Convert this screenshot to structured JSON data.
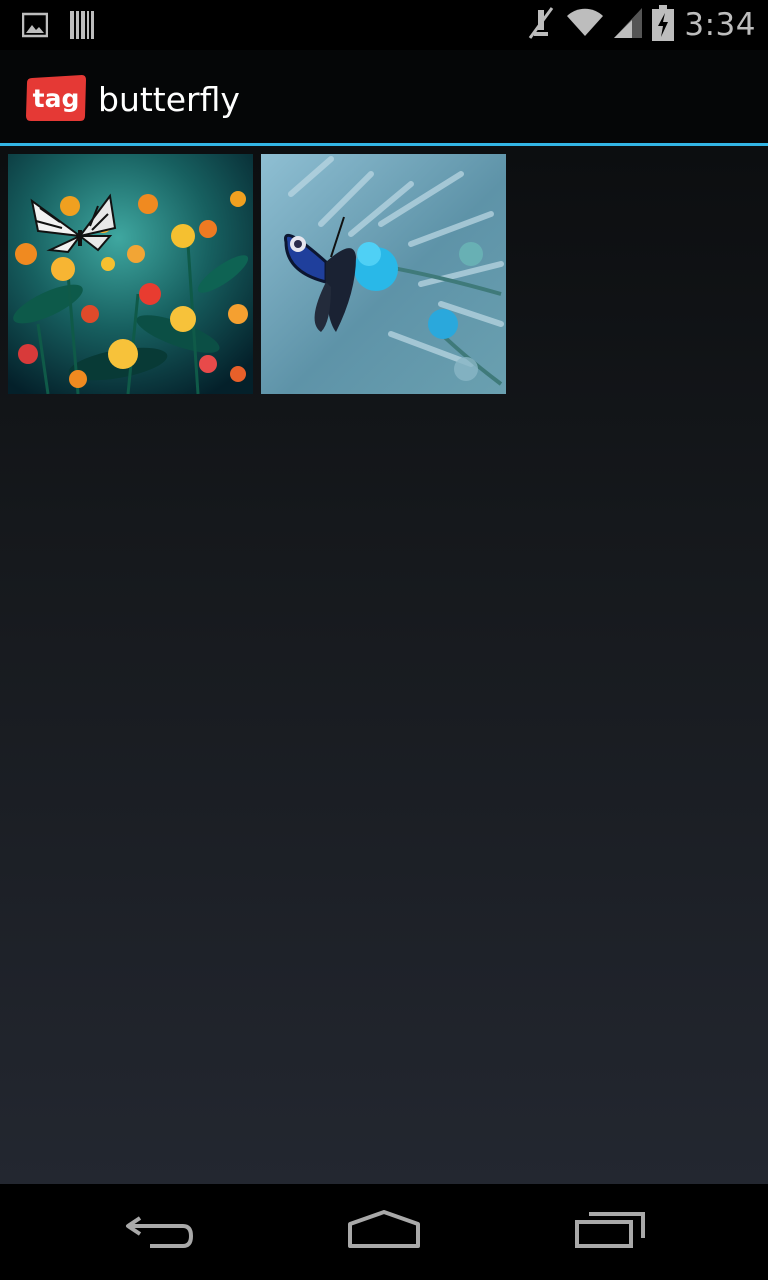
{
  "status_bar": {
    "time": "3:34",
    "icons": [
      "gallery-notification-icon",
      "barcode-notification-icon",
      "muted-icon",
      "wifi-icon",
      "cell-signal-icon",
      "battery-charging-icon"
    ]
  },
  "action_bar": {
    "logo_text": "tag",
    "title": "butterfly",
    "accent_color": "#33b5e5",
    "logo_color": "#e53935"
  },
  "gallery": {
    "items": [
      {
        "description_icon": "butterfly-on-flowers-photo"
      },
      {
        "description_icon": "peacock-butterfly-photo"
      }
    ]
  },
  "nav_bar": {
    "icons": [
      "back-icon",
      "home-icon",
      "recents-icon"
    ]
  }
}
